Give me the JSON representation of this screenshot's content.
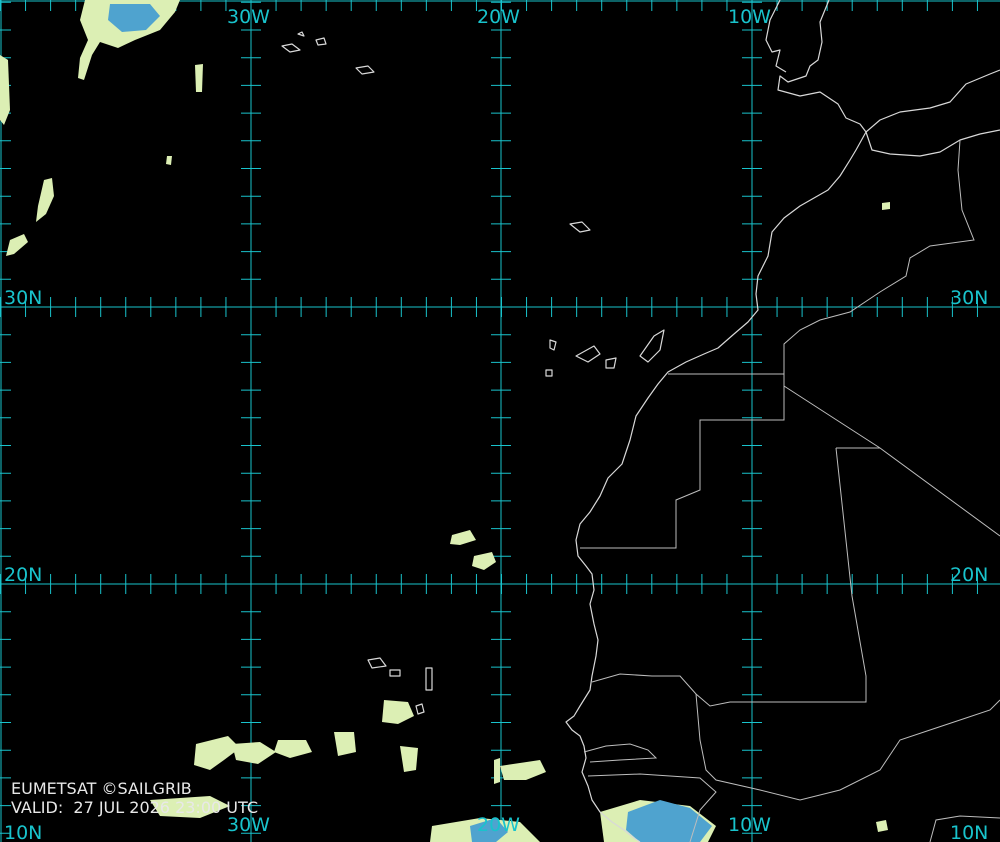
{
  "map": {
    "credit": "EUMETSAT ©SAILGRIB",
    "valid_label": "VALID:",
    "valid_time": "27 JUL 2026 23:00 UTC",
    "longitude_labels": [
      "30W",
      "20W",
      "10W"
    ],
    "latitude_labels": [
      "30N",
      "20N",
      "10N"
    ],
    "colors": {
      "background": "#000000",
      "grid": "#19c3cc",
      "coastline": "#d8d8d8",
      "cloud_warm": "#dcefb4",
      "cloud_cold": "#4fa3cf"
    }
  }
}
